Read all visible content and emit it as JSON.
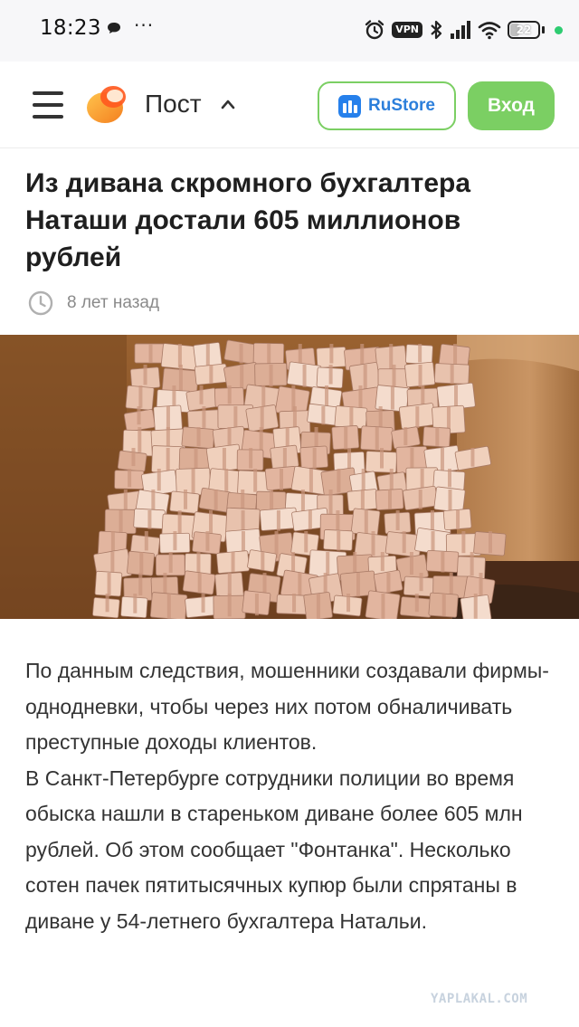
{
  "status_bar": {
    "time": "18:23",
    "dots": "···",
    "vpn_label": "VPN",
    "battery_level": "22",
    "indicator_color": "#2ecc71"
  },
  "header": {
    "section_title": "Пост",
    "rustore_label": "RuStore",
    "login_label": "Вход",
    "accent_color": "#7bcf63"
  },
  "post": {
    "title": "Из дивана скромного бухгалтера Наташи достали 605 миллионов рублей",
    "date": "8 лет назад",
    "paragraphs": [
      "По данным следствия, мошенники создавали фирмы-однодневки, чтобы через них потом обналичивать преступные доходы клиентов.",
      "В Санкт-Петербурге сотрудники полиции во время обыска нашли в стареньком диване более 605 млн рублей. Об этом сообщает \"Фонтанка\". Несколько сотен пачек пятитысячных купюр были спрятаны в диване у 54-летнего бухгалтера Натальи."
    ]
  },
  "watermark": "YAPLAKAL.COM"
}
